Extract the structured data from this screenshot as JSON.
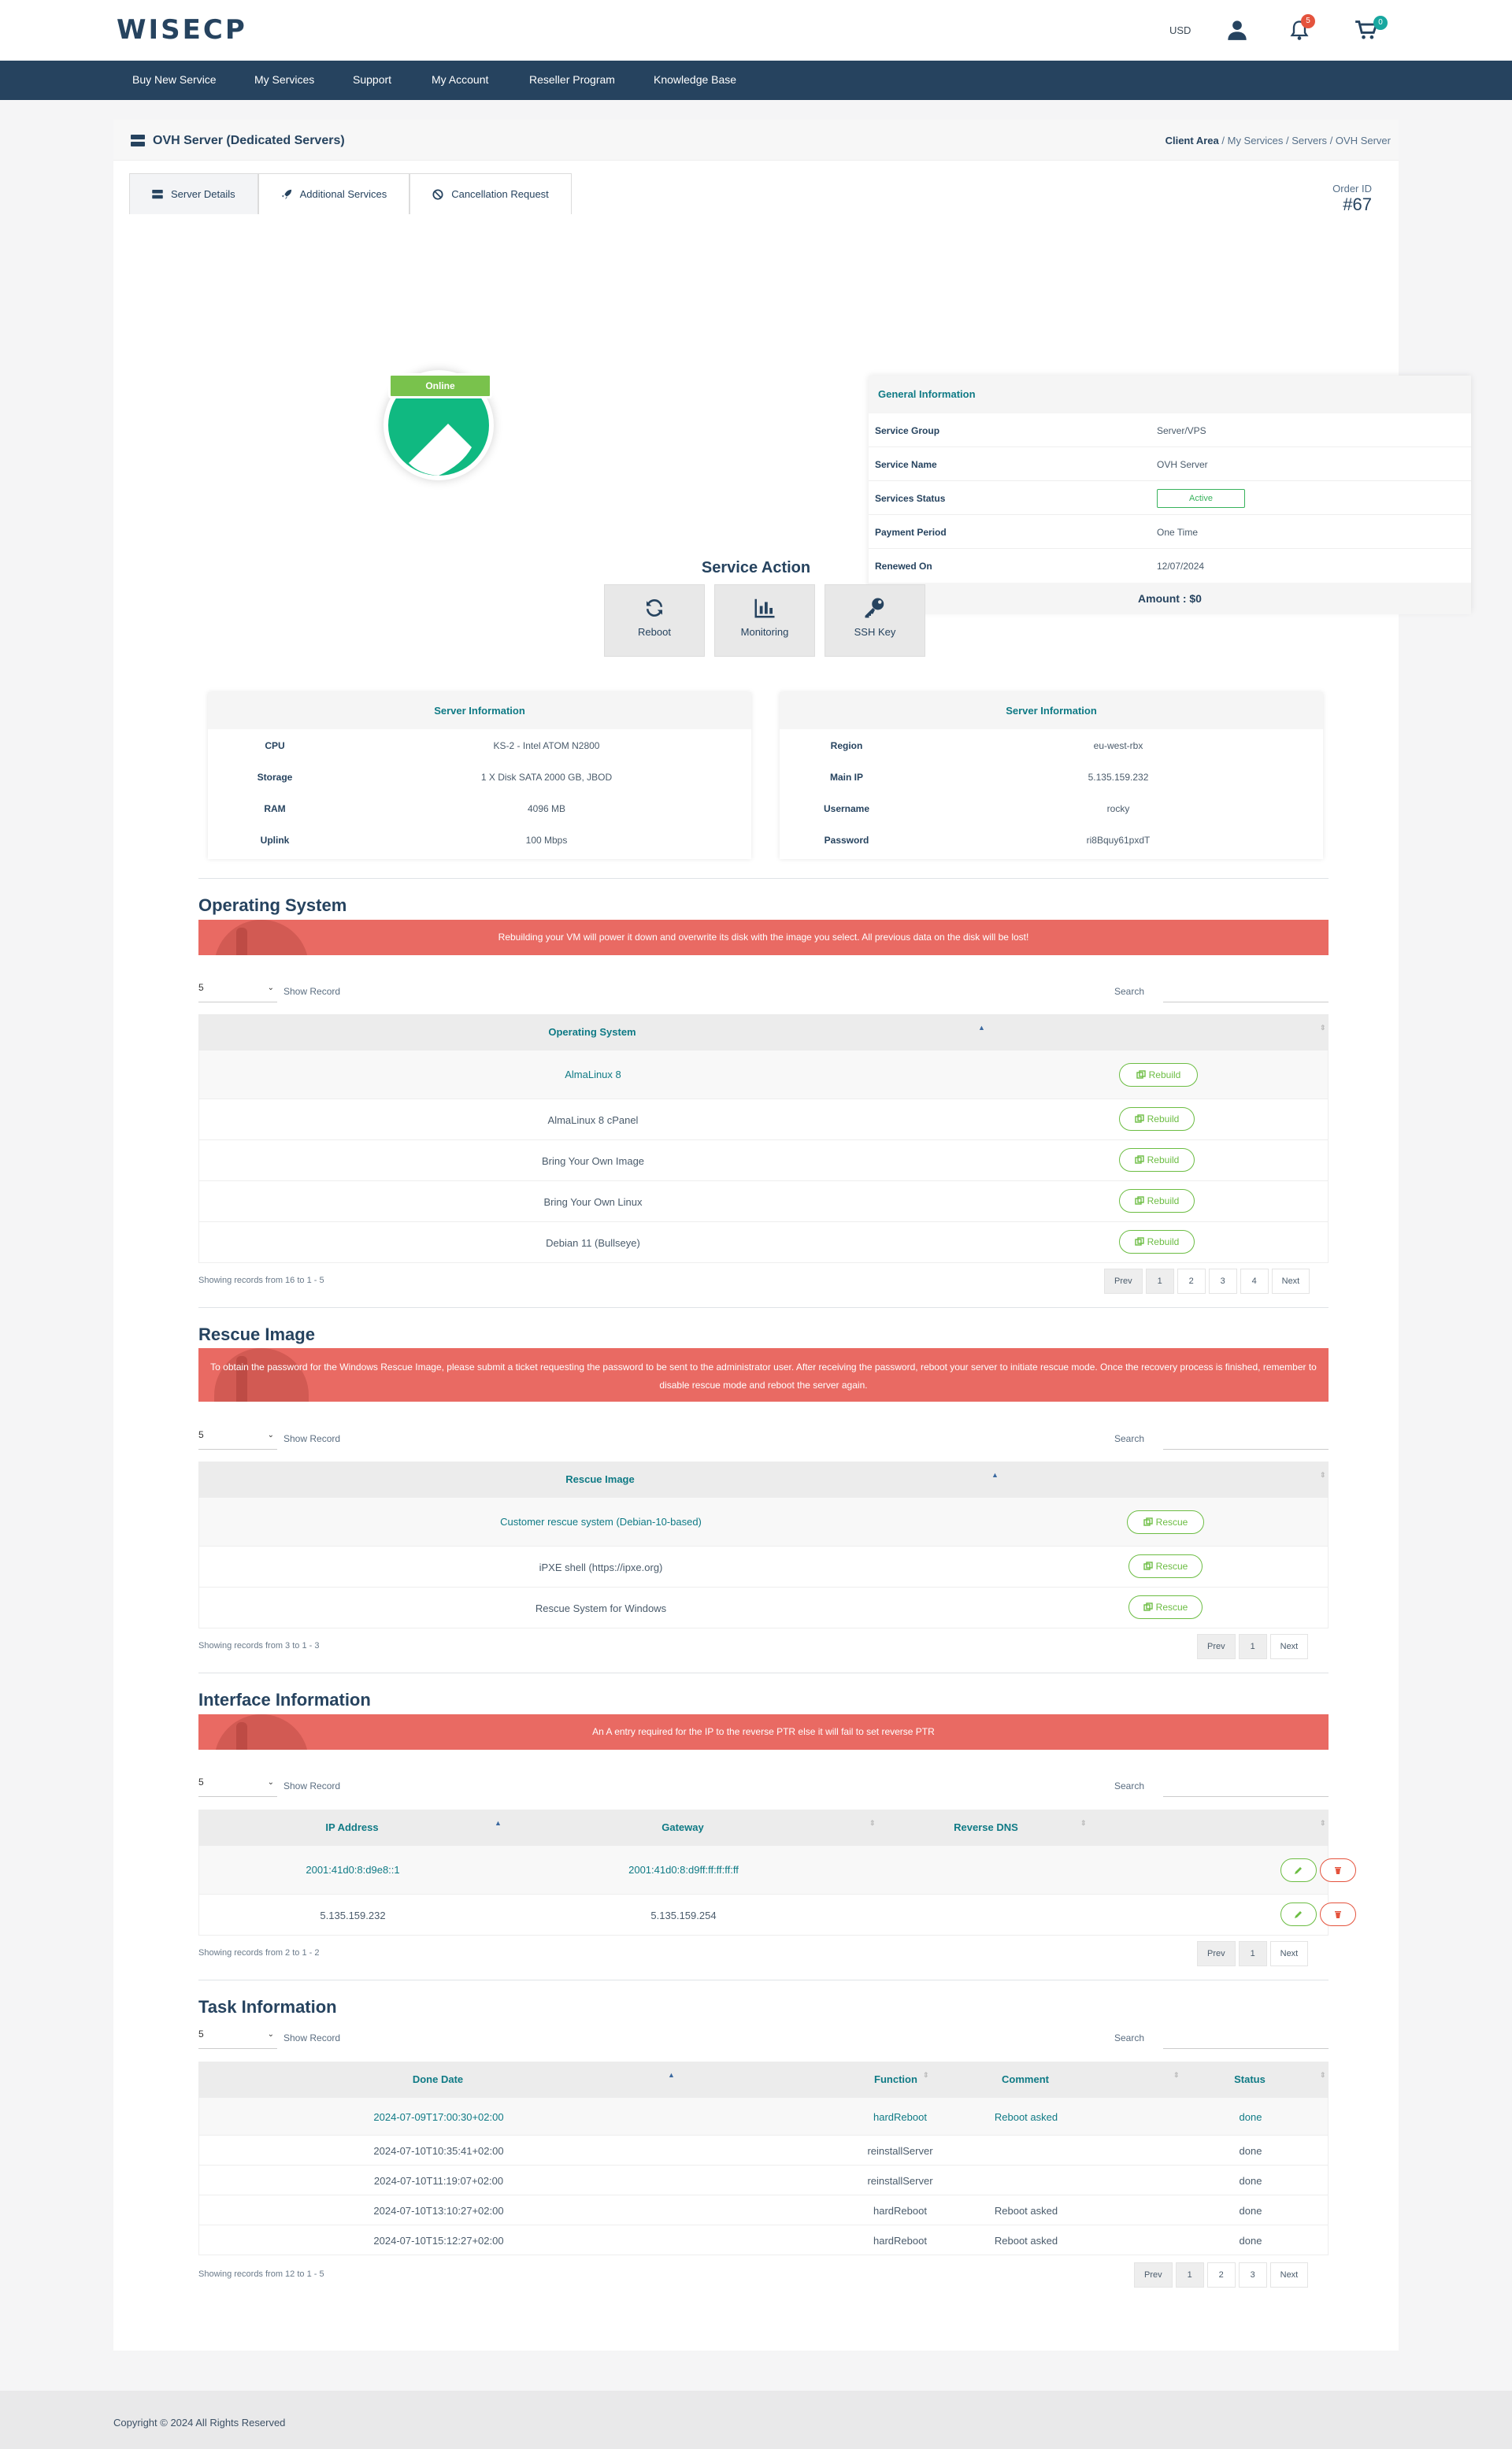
{
  "header": {
    "logo": "WISECP",
    "currency": "USD",
    "notification_count": "5",
    "cart_count": "0",
    "icons": [
      "user-icon",
      "bell-icon",
      "cart-icon"
    ]
  },
  "nav": [
    "Buy New Service",
    "My Services",
    "Support",
    "My Account",
    "Reseller Program",
    "Knowledge Base"
  ],
  "page": {
    "title": "OVH Server (Dedicated Servers)",
    "breadcrumb": [
      "Client Area",
      "My Services",
      "Servers",
      "OVH Server"
    ],
    "tabs": [
      "Server Details",
      "Additional Services",
      "Cancellation Request"
    ],
    "order_id_label": "Order ID",
    "order_id": "#67",
    "status_ribbon": "Online"
  },
  "general": {
    "title": "General Information",
    "rows": [
      {
        "k": "Service Group",
        "v": "Server/VPS"
      },
      {
        "k": "Service Name",
        "v": "OVH Server"
      },
      {
        "k": "Services Status",
        "v": "Active"
      },
      {
        "k": "Payment Period",
        "v": "One Time"
      },
      {
        "k": "Renewed On",
        "v": "12/07/2024"
      }
    ],
    "amount": "Amount : $0"
  },
  "service_action": {
    "title": "Service Action",
    "buttons": [
      "Reboot",
      "Monitoring",
      "SSH Key"
    ]
  },
  "server_info_left": {
    "title": "Server Information",
    "rows": [
      {
        "k": "CPU",
        "v": "KS-2 - Intel ATOM N2800"
      },
      {
        "k": "Storage",
        "v": "1 X Disk SATA 2000 GB, JBOD"
      },
      {
        "k": "RAM",
        "v": "4096 MB"
      },
      {
        "k": "Uplink",
        "v": "100 Mbps"
      }
    ]
  },
  "server_info_right": {
    "title": "Server Information",
    "rows": [
      {
        "k": "Region",
        "v": "eu-west-rbx"
      },
      {
        "k": "Main IP",
        "v": "5.135.159.232"
      },
      {
        "k": "Username",
        "v": "rocky"
      },
      {
        "k": "Password",
        "v": "ri8Bquy61pxdT"
      }
    ]
  },
  "common": {
    "page_len": "5",
    "show_record": "Show Record",
    "search": "Search",
    "prev": "Prev",
    "next": "Next"
  },
  "os": {
    "title": "Operating System",
    "alert": "Rebuilding your VM will power it down and overwrite its disk with the image you select. All previous data on the disk will be lost!",
    "column": "Operating System",
    "rows": [
      "AlmaLinux 8",
      "AlmaLinux 8 cPanel",
      "Bring Your Own Image",
      "Bring Your Own Linux",
      "Debian 11 (Bullseye)"
    ],
    "action": "Rebuild",
    "info": "Showing records from 16 to 1 - 5",
    "pages": [
      "1",
      "2",
      "3",
      "4"
    ]
  },
  "rescue": {
    "title": "Rescue Image",
    "alert": "To obtain the password for the Windows Rescue Image, please submit a ticket requesting the password to be sent to the administrator user. After receiving the password, reboot your server to initiate rescue mode. Once the recovery process is finished, remember to disable rescue mode and reboot the server again.",
    "column": "Rescue Image",
    "rows": [
      "Customer rescue system (Debian-10-based)",
      "iPXE shell (https://ipxe.org)",
      "Rescue System for Windows"
    ],
    "action": "Rescue",
    "info": "Showing records from 3 to 1 - 3",
    "pages": [
      "1"
    ]
  },
  "interface": {
    "title": "Interface Information",
    "alert": "An A entry required for the IP to the reverse PTR else it will fail to set reverse PTR",
    "columns": [
      "IP Address",
      "Gateway",
      "Reverse DNS"
    ],
    "rows": [
      {
        "ip": "2001:41d0:8:d9e8::1",
        "gw": "2001:41d0:8:d9ff:ff:ff:ff:ff",
        "rdns": ""
      },
      {
        "ip": "5.135.159.232",
        "gw": "5.135.159.254",
        "rdns": ""
      }
    ],
    "info": "Showing records from 2 to 1 - 2",
    "pages": [
      "1"
    ]
  },
  "tasks": {
    "title": "Task Information",
    "columns": [
      "Done Date",
      "Function",
      "Comment",
      "Status"
    ],
    "rows": [
      {
        "date": "2024-07-09T17:00:30+02:00",
        "fn": "hardReboot",
        "comment": "Reboot asked",
        "status": "done"
      },
      {
        "date": "2024-07-10T10:35:41+02:00",
        "fn": "reinstallServer",
        "comment": "",
        "status": "done"
      },
      {
        "date": "2024-07-10T11:19:07+02:00",
        "fn": "reinstallServer",
        "comment": "",
        "status": "done"
      },
      {
        "date": "2024-07-10T13:10:27+02:00",
        "fn": "hardReboot",
        "comment": "Reboot asked",
        "status": "done"
      },
      {
        "date": "2024-07-10T15:12:27+02:00",
        "fn": "hardReboot",
        "comment": "Reboot asked",
        "status": "done"
      }
    ],
    "info": "Showing records from 12 to 1 - 5",
    "pages": [
      "1",
      "2",
      "3"
    ]
  },
  "footer": "Copyright © 2024 All Rights Reserved",
  "colors": {
    "brand": "#26435f",
    "teal": "#0f7a85",
    "green": "#6cbd43",
    "alert": "#e96a63",
    "danger": "#e4533d"
  }
}
